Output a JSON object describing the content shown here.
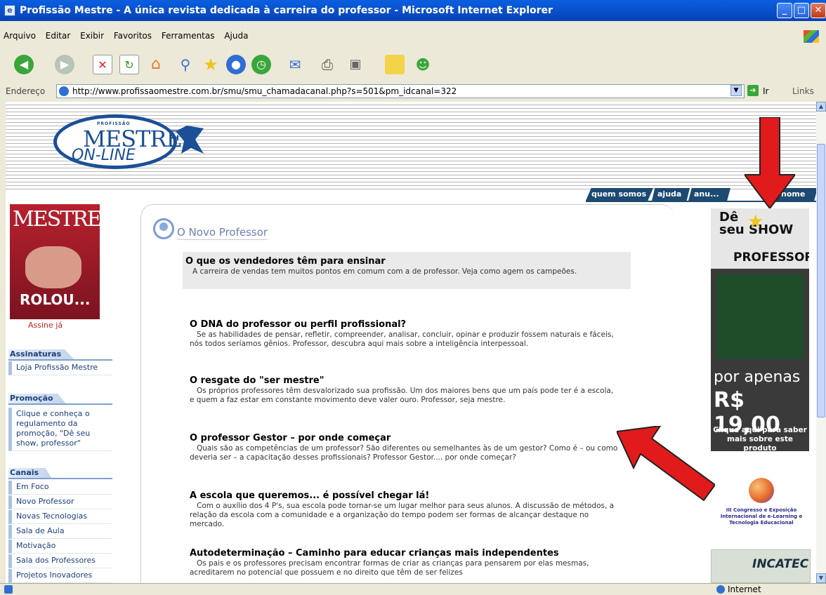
{
  "window": {
    "title": "Profissão Mestre - A única revista dedicada à carreira do professor - Microsoft Internet Explorer"
  },
  "menu": [
    "Arquivo",
    "Editar",
    "Exibir",
    "Favoritos",
    "Ferramentas",
    "Ajuda"
  ],
  "address": {
    "label": "Endereço",
    "url": "http://www.profissaomestre.com.br/smu/smu_chamadacanal.php?s=501&pm_idcanal=322",
    "go_label": "Ir",
    "links_label": "Links"
  },
  "status": {
    "zone": "Internet"
  },
  "logo": {
    "small": "PROFISSÃO",
    "big": "MESTRE",
    "online": "ON-LINE"
  },
  "nav": [
    "quem somos",
    "ajuda",
    "anu...",
    "home"
  ],
  "sidebar": {
    "magazine": {
      "title": "MESTRE",
      "headline": "ROLOU..."
    },
    "assine": "Assine já",
    "assinaturas": {
      "heading": "Assinaturas",
      "items": [
        "Loja Profissão Mestre"
      ]
    },
    "promocao": {
      "heading": "Promoção",
      "text": "Clique e conheça o regulamento da promoção, \"Dê seu show, professor\""
    },
    "canais": {
      "heading": "Canais",
      "items": [
        "Em Foco",
        "Novo Professor",
        "Novas Tecnologias",
        "Sala de Aula",
        "Motivação",
        "Sala dos Professores",
        "Projetos Inovadores"
      ]
    }
  },
  "main": {
    "section_title": "O Novo Professor",
    "featured": {
      "title": "O que os vendedores têm para ensinar",
      "summary": "A carreira de vendas tem muitos pontos em comum com a de professor. Veja como agem os campeões."
    },
    "articles": [
      {
        "title": "O DNA do professor ou perfil profissional?",
        "summary": "Se as habilidades de pensar, refletir, compreender, analisar, concluir, opinar e produzir fossem naturais e fáceis, nós todos seríamos gênios. Professor, descubra aqui mais sobre a inteligência interpessoal."
      },
      {
        "title": "O resgate do \"ser mestre\"",
        "summary": "Os próprios professores têm desvalorizado sua profissão. Um dos maiores bens que um país pode ter é a escola, e quem a faz estar em constante movimento deve valer ouro. Professor, seja mestre."
      },
      {
        "title": "O professor Gestor – por onde começar",
        "summary": "Quais são as competências de um professor? São diferentes ou semelhantes às de um gestor? Como é – ou como deveria ser – a capacitação desses profissionais? Professor Gestor.... por onde começar?"
      },
      {
        "title": "A escola que queremos... é possível chegar lá!",
        "summary": "Com o auxílio dos 4 P's, sua escola pode tornar-se um lugar melhor para seus alunos. A discussão de métodos, a relação da escola com a comunidade e a organização do tempo podem ser formas de alcançar destaque no mercado."
      },
      {
        "title": "Autodeterminação – Caminho para educar crianças mais independentes",
        "summary": "Os pais e os professores precisam encontrar formas de criar as crianças para pensarem por elas mesmas, acreditarem no potencial que possuem e no direito que têm de ser felizes"
      }
    ]
  },
  "ads": {
    "show": {
      "de": "Dê",
      "seu": "seu",
      "show": "SHOW",
      "professor": "PROFESSOR",
      "por_apenas": "por apenas",
      "price": "R$ 19,00",
      "cta": "Clique aqui para saber mais sobre este produto"
    },
    "congresso": {
      "text": "III Congresso e Exposição Internacional de e-Learning e Tecnologia Educacional"
    },
    "incatec": {
      "name": "INCATEC"
    }
  },
  "colors": {
    "nav": "#1c4a72",
    "link": "#1c3f7a",
    "arrow": "#e11b1b",
    "assine": "#c52222"
  }
}
